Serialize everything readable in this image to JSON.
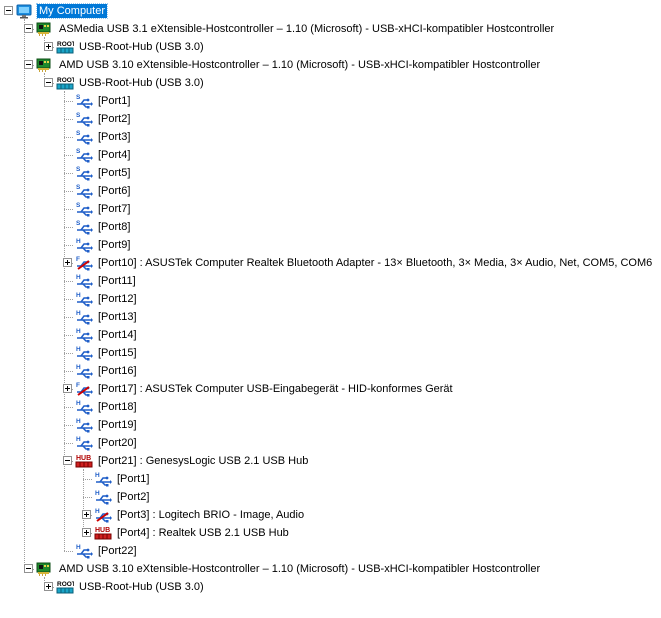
{
  "colors": {
    "selection": "#0078d7",
    "tree_line": "#a0a0a0",
    "usb_blue": "#1f5ec8",
    "error_red": "#d00000"
  },
  "tree": [
    {
      "label": "My Computer",
      "icon": "computer-icon",
      "depth": 0,
      "expander": "minus",
      "selected": true
    },
    {
      "label": "ASMedia USB 3.1 eXtensible-Hostcontroller – 1.10 (Microsoft) - USB-xHCI-kompatibler Hostcontroller",
      "icon": "pci-card-icon",
      "depth": 1,
      "expander": "minus"
    },
    {
      "label": "USB-Root-Hub (USB 3.0)",
      "icon": "root-hub-icon",
      "icon_text": "ROOT",
      "depth": 2,
      "expander": "plus"
    },
    {
      "label": "AMD USB 3.10 eXtensible-Hostcontroller – 1.10 (Microsoft) - USB-xHCI-kompatibler Hostcontroller",
      "icon": "pci-card-icon",
      "depth": 1,
      "expander": "minus"
    },
    {
      "label": "USB-Root-Hub (USB 3.0)",
      "icon": "root-hub-icon",
      "icon_text": "ROOT",
      "depth": 2,
      "expander": "minus"
    },
    {
      "label": "[Port1]",
      "icon": "usb-port-icon",
      "icon_text": "S",
      "depth": 3
    },
    {
      "label": "[Port2]",
      "icon": "usb-port-icon",
      "icon_text": "S",
      "depth": 3
    },
    {
      "label": "[Port3]",
      "icon": "usb-port-icon",
      "icon_text": "S",
      "depth": 3
    },
    {
      "label": "[Port4]",
      "icon": "usb-port-icon",
      "icon_text": "S",
      "depth": 3
    },
    {
      "label": "[Port5]",
      "icon": "usb-port-icon",
      "icon_text": "S",
      "depth": 3
    },
    {
      "label": "[Port6]",
      "icon": "usb-port-icon",
      "icon_text": "S",
      "depth": 3
    },
    {
      "label": "[Port7]",
      "icon": "usb-port-icon",
      "icon_text": "S",
      "depth": 3
    },
    {
      "label": "[Port8]",
      "icon": "usb-port-icon",
      "icon_text": "S",
      "depth": 3
    },
    {
      "label": "[Port9]",
      "icon": "usb-port-icon",
      "icon_text": "H",
      "depth": 3
    },
    {
      "label": "[Port10] : ASUSTek Computer Realtek Bluetooth Adapter - 13× Bluetooth, 3× Media, 3× Audio, Net, COM5, COM6",
      "icon": "usb-device-icon",
      "icon_text": "F",
      "depth": 3,
      "expander": "plus"
    },
    {
      "label": "[Port11]",
      "icon": "usb-port-icon",
      "icon_text": "H",
      "depth": 3
    },
    {
      "label": "[Port12]",
      "icon": "usb-port-icon",
      "icon_text": "H",
      "depth": 3
    },
    {
      "label": "[Port13]",
      "icon": "usb-port-icon",
      "icon_text": "H",
      "depth": 3
    },
    {
      "label": "[Port14]",
      "icon": "usb-port-icon",
      "icon_text": "H",
      "depth": 3
    },
    {
      "label": "[Port15]",
      "icon": "usb-port-icon",
      "icon_text": "H",
      "depth": 3
    },
    {
      "label": "[Port16]",
      "icon": "usb-port-icon",
      "icon_text": "H",
      "depth": 3
    },
    {
      "label": "[Port17] : ASUSTek Computer USB-Eingabegerät - HID-konformes Gerät",
      "icon": "usb-device-icon",
      "icon_text": "F",
      "depth": 3,
      "expander": "plus"
    },
    {
      "label": "[Port18]",
      "icon": "usb-port-icon",
      "icon_text": "H",
      "depth": 3
    },
    {
      "label": "[Port19]",
      "icon": "usb-port-icon",
      "icon_text": "H",
      "depth": 3
    },
    {
      "label": "[Port20]",
      "icon": "usb-port-icon",
      "icon_text": "H",
      "depth": 3
    },
    {
      "label": "[Port21] : GenesysLogic USB 2.1 USB Hub",
      "icon": "usb-hub-icon",
      "icon_text": "HUB",
      "depth": 3,
      "expander": "minus"
    },
    {
      "label": "[Port1]",
      "icon": "usb-port-icon",
      "icon_text": "H",
      "depth": 4
    },
    {
      "label": "[Port2]",
      "icon": "usb-port-icon",
      "icon_text": "H",
      "depth": 4
    },
    {
      "label": "[Port3] : Logitech BRIO - Image, Audio",
      "icon": "usb-device-icon",
      "icon_text": "H",
      "depth": 4,
      "expander": "plus"
    },
    {
      "label": "[Port4] : Realtek USB 2.1 USB Hub",
      "icon": "usb-hub-icon",
      "icon_text": "HUB",
      "depth": 4,
      "expander": "plus"
    },
    {
      "label": "[Port22]",
      "icon": "usb-port-icon",
      "icon_text": "H",
      "depth": 3
    },
    {
      "label": "AMD USB 3.10 eXtensible-Hostcontroller – 1.10 (Microsoft) - USB-xHCI-kompatibler Hostcontroller",
      "icon": "pci-card-icon",
      "depth": 1,
      "expander": "minus"
    },
    {
      "label": "USB-Root-Hub (USB 3.0)",
      "icon": "root-hub-icon",
      "icon_text": "ROOT",
      "depth": 2,
      "expander": "plus"
    }
  ]
}
